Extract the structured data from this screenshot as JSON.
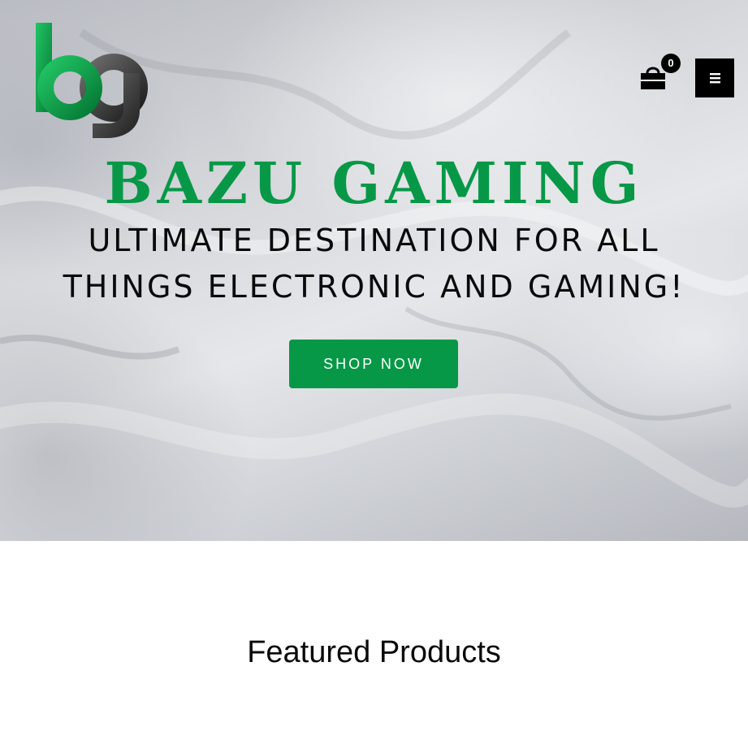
{
  "header": {
    "logo_icon": "bg-monogram-logo",
    "cart": {
      "icon": "shopping-bag-icon",
      "count": "0"
    },
    "menu": {
      "icon": "hamburger-menu-icon"
    }
  },
  "hero": {
    "title": "BAZU GAMING",
    "tagline_line1": "ULTIMATE DESTINATION FOR ALL",
    "tagline_line2": "THINGS ELECTRONIC AND GAMING!",
    "cta_label": "SHOP NOW"
  },
  "featured": {
    "title": "Featured Products"
  },
  "colors": {
    "brand_green": "#079847",
    "dark": "#000000",
    "white": "#ffffff"
  }
}
